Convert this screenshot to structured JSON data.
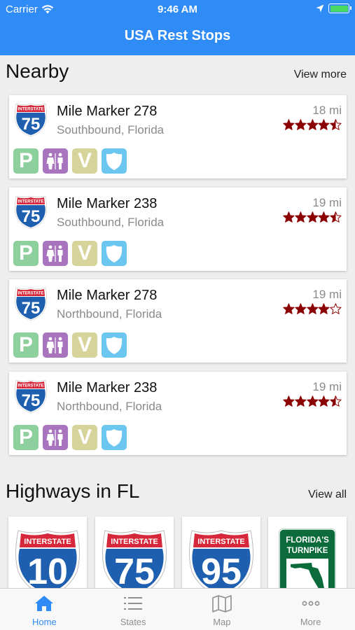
{
  "status": {
    "carrier": "Carrier",
    "time": "9:46 AM"
  },
  "nav": {
    "title": "USA Rest Stops"
  },
  "nearby": {
    "heading": "Nearby",
    "link": "View more",
    "items": [
      {
        "route": "75",
        "shield_label": "INTERSTATE",
        "title": "Mile Marker 278",
        "subtitle": "Southbound, Florida",
        "distance": "18 mi",
        "rating": 4.5
      },
      {
        "route": "75",
        "shield_label": "INTERSTATE",
        "title": "Mile Marker 238",
        "subtitle": "Southbound, Florida",
        "distance": "19 mi",
        "rating": 4.5
      },
      {
        "route": "75",
        "shield_label": "INTERSTATE",
        "title": "Mile Marker 278",
        "subtitle": "Northbound, Florida",
        "distance": "19 mi",
        "rating": 4
      },
      {
        "route": "75",
        "shield_label": "INTERSTATE",
        "title": "Mile Marker 238",
        "subtitle": "Northbound, Florida",
        "distance": "19 mi",
        "rating": 4.5
      }
    ],
    "amenities": {
      "parking": "P",
      "vending": "V"
    }
  },
  "highways": {
    "heading": "Highways in FL",
    "link": "View all",
    "items": [
      {
        "type": "interstate",
        "label": "INTERSTATE",
        "number": "10"
      },
      {
        "type": "interstate",
        "label": "INTERSTATE",
        "number": "75"
      },
      {
        "type": "interstate",
        "label": "INTERSTATE",
        "number": "95"
      },
      {
        "type": "turnpike",
        "label1": "FLORIDA'S",
        "label2": "TURNPIKE"
      }
    ]
  },
  "tabs": [
    {
      "label": "Home",
      "icon": "home-icon",
      "active": true
    },
    {
      "label": "States",
      "icon": "list-icon",
      "active": false
    },
    {
      "label": "Map",
      "icon": "map-icon",
      "active": false
    },
    {
      "label": "More",
      "icon": "more-icon",
      "active": false
    }
  ],
  "colors": {
    "accent": "#2f8bf5",
    "star": "#8b0000",
    "shield_blue": "#1f5fb0",
    "shield_red": "#d6283a",
    "turnpike_green": "#0b6b3a"
  }
}
